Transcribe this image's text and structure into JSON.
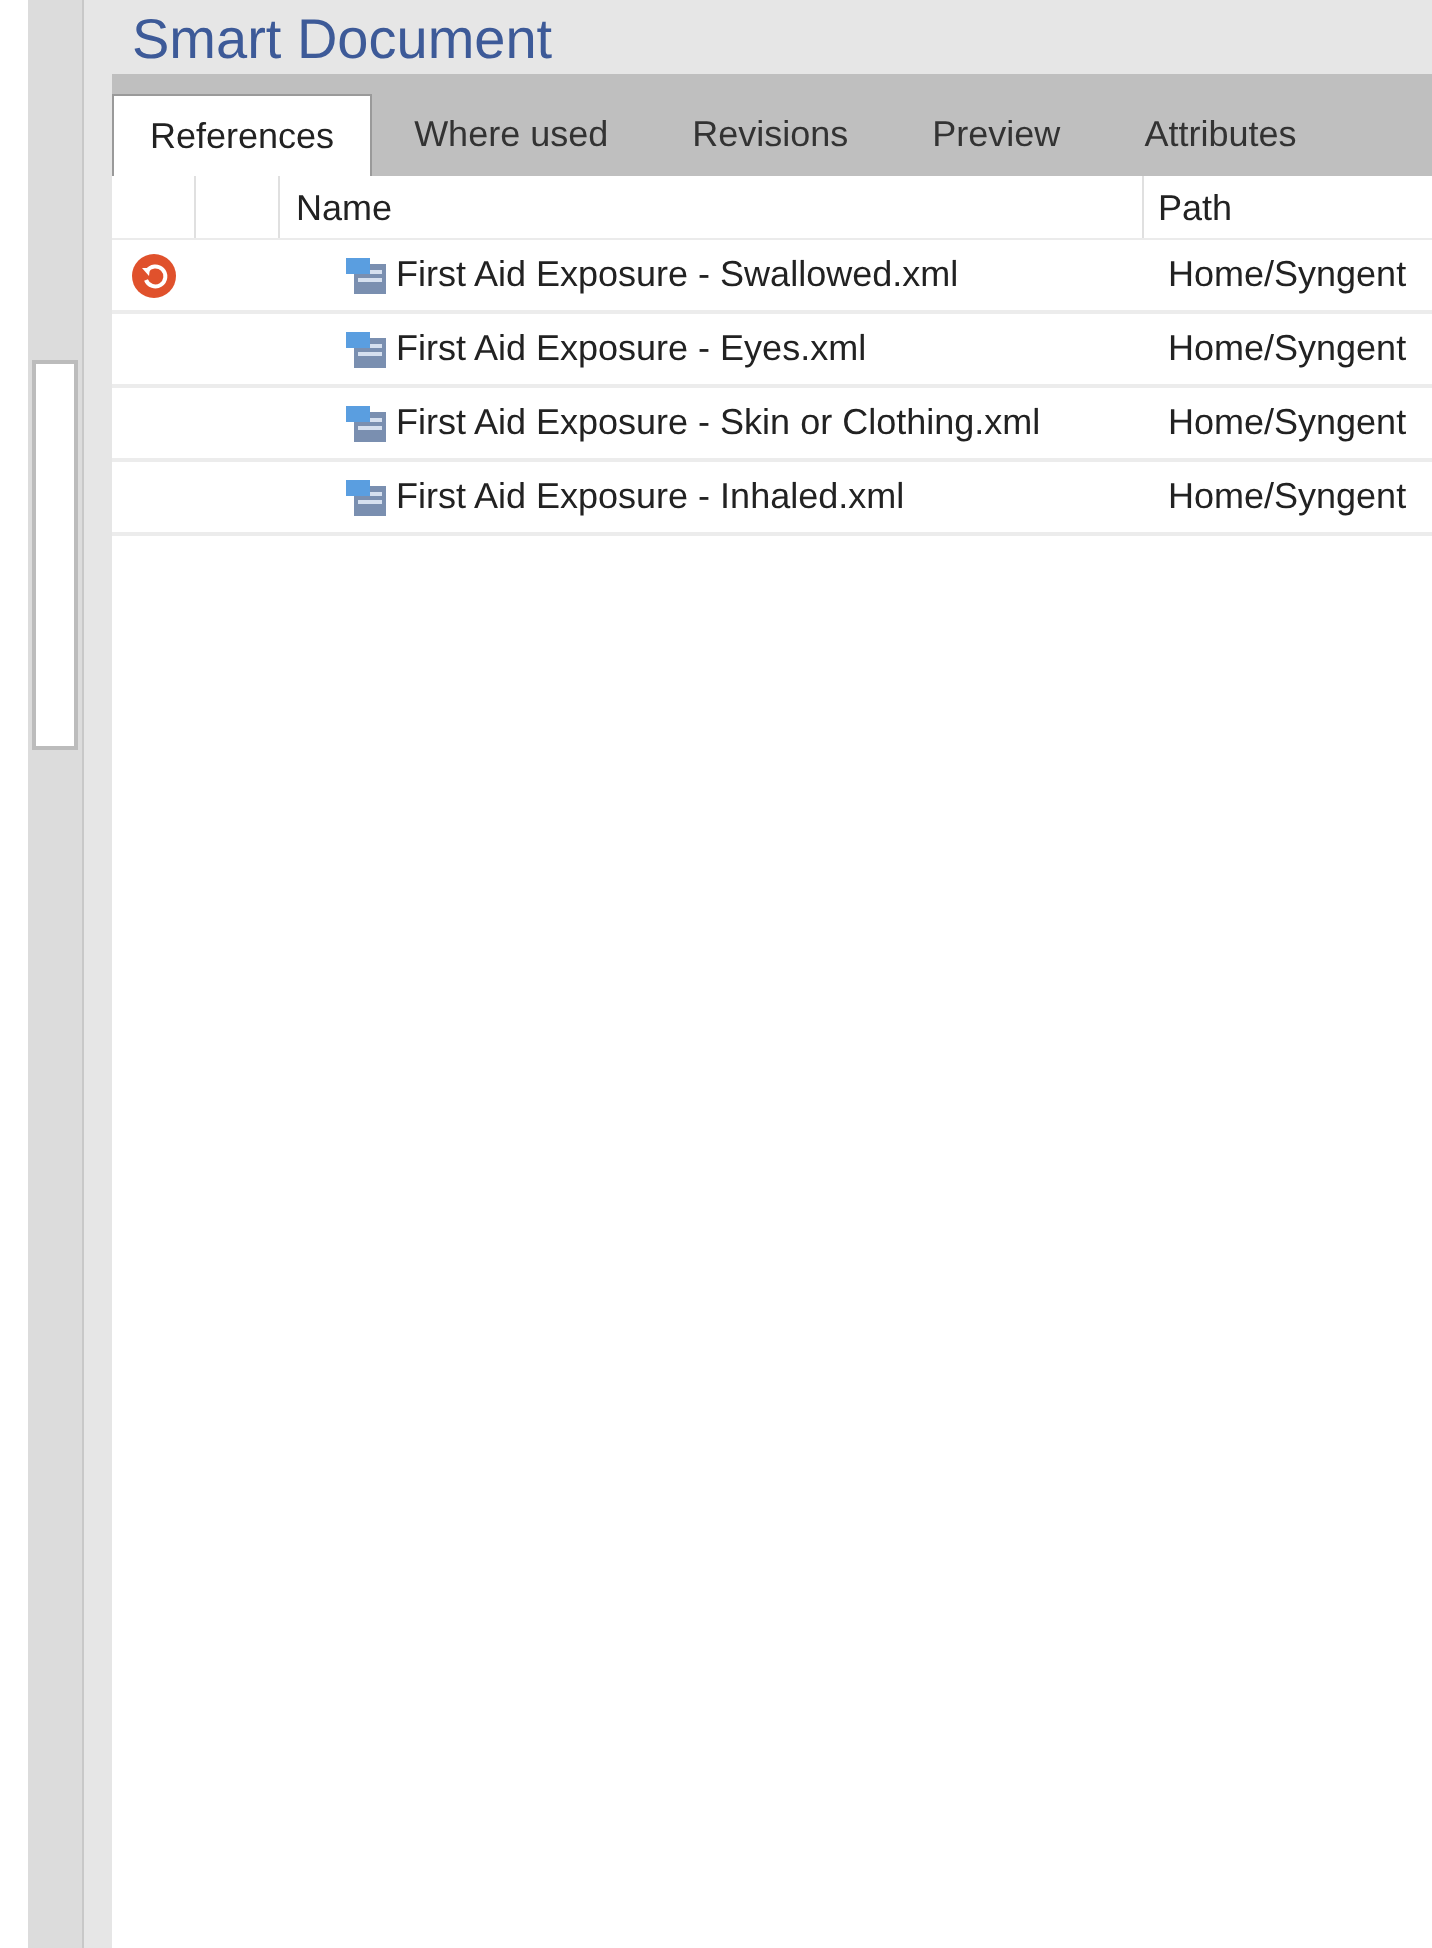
{
  "title": "Smart Document",
  "tabs": [
    {
      "label": "References",
      "selected": true
    },
    {
      "label": "Where used",
      "selected": false
    },
    {
      "label": "Revisions",
      "selected": false
    },
    {
      "label": "Preview",
      "selected": false
    },
    {
      "label": "Attributes",
      "selected": false
    }
  ],
  "table": {
    "columns": [
      "Name",
      "Path"
    ],
    "rows": [
      {
        "flagged": true,
        "name": "First Aid Exposure - Swallowed.xml",
        "path": "Home/Syngent"
      },
      {
        "flagged": false,
        "name": "First Aid Exposure - Eyes.xml",
        "path": "Home/Syngent"
      },
      {
        "flagged": false,
        "name": "First Aid Exposure - Skin or Clothing.xml",
        "path": "Home/Syngent"
      },
      {
        "flagged": false,
        "name": "First Aid Exposure - Inhaled.xml",
        "path": "Home/Syngent"
      }
    ]
  }
}
